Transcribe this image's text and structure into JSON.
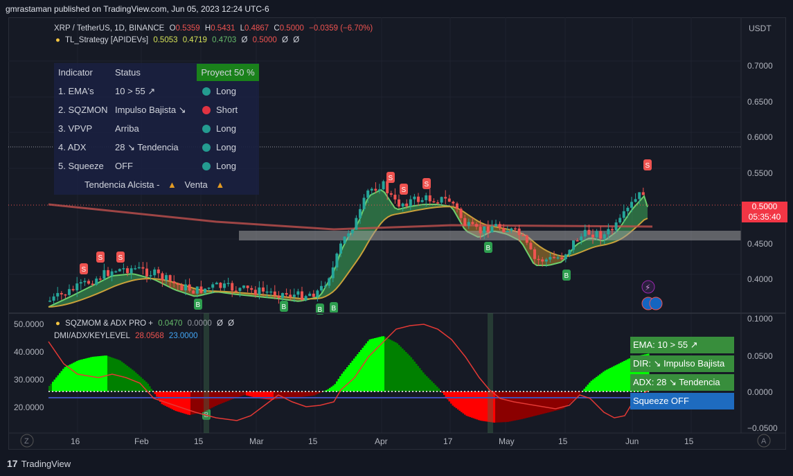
{
  "header": {
    "publish": "gmrastaman published on TradingView.com, Jun 05, 2023 12:24 UTC-6"
  },
  "symbol_legend": {
    "symbol": "XRP / TetherUS, 1D, BINANCE",
    "o_lbl": "O",
    "o": "0.5359",
    "h_lbl": "H",
    "h": "0.5431",
    "l_lbl": "L",
    "l": "0.4867",
    "c_lbl": "C",
    "c": "0.5000",
    "change": "−0.0359 (−6.70%)"
  },
  "strategy_legend": {
    "name": "TL_Strategy [APIDEVs]",
    "v1": "0.5053",
    "v2": "0.4719",
    "v3": "0.4703",
    "v4": "Ø",
    "v5": "0.5000",
    "v6": "Ø",
    "v7": "Ø"
  },
  "indicator_table": {
    "header": {
      "indicator": "Indicator",
      "status": "Status",
      "project": "Proyect 50 %"
    },
    "rows": [
      {
        "indicator": "1. EMA's",
        "status": "10 > 55 ↗",
        "signal": "Long",
        "color": "#26a69a"
      },
      {
        "indicator": "2. SQZMON",
        "status": "Impulso Bajista ↘",
        "signal": "Short",
        "color": "#f23645"
      },
      {
        "indicator": "3. VPVP",
        "status": "Arriba",
        "signal": "Long",
        "color": "#26a69a"
      },
      {
        "indicator": "4. ADX",
        "status": "28 ↘ Tendencia",
        "signal": "Long",
        "color": "#26a69a"
      },
      {
        "indicator": "5. Squeeze",
        "status": "OFF",
        "signal": "Long",
        "color": "#26a69a"
      }
    ],
    "footer_a": "Tendencia Alcista -",
    "footer_b": "Venta"
  },
  "price_axis": {
    "currency": "USDT",
    "ticks": [
      "0.7000",
      "0.6500",
      "0.6000",
      "0.5500",
      "0.4500",
      "0.4000"
    ],
    "last_price": "0.5000",
    "countdown": "05:35:40"
  },
  "lower_pane": {
    "left_ticks": [
      "50.0000",
      "40.0000",
      "30.0000",
      "20.0000"
    ],
    "right_ticks": [
      "0.1000",
      "0.0500",
      "0.0000",
      "−0.0500"
    ],
    "legend1_name": "SQZMOM & ADX PRO +",
    "legend1_v1": "0.0470",
    "legend1_v2": "0.0000",
    "legend1_v3": "Ø",
    "legend1_v4": "Ø",
    "legend2_name": "DMI/ADX/KEYLEVEL",
    "legend2_v1": "28.0568",
    "legend2_v2": "23.0000",
    "panels": [
      {
        "text": "EMA: 10 > 55 ↗",
        "color": "#388e3c"
      },
      {
        "text": "DIR: ↘ Impulso Bajista",
        "color": "#388e3c"
      },
      {
        "text": "ADX: 28 ↘ Tendencia",
        "color": "#388e3c"
      },
      {
        "text": "Squeeze OFF",
        "color": "#1e6bbf"
      }
    ]
  },
  "time_axis": [
    "16",
    "Feb",
    "15",
    "Mar",
    "15",
    "Apr",
    "17",
    "May",
    "15",
    "Jun",
    "15"
  ],
  "signals": {
    "sell": "S",
    "buy": "B"
  },
  "footer": {
    "brand": "TradingView"
  },
  "colors": {
    "up": "#26a69a",
    "down": "#ef5350",
    "bg": "#161a25",
    "grid": "#1f2330",
    "bright_green": "#00ff00",
    "dark_green": "#008000",
    "red": "#ff0000",
    "dark_red": "#8b0000"
  }
}
